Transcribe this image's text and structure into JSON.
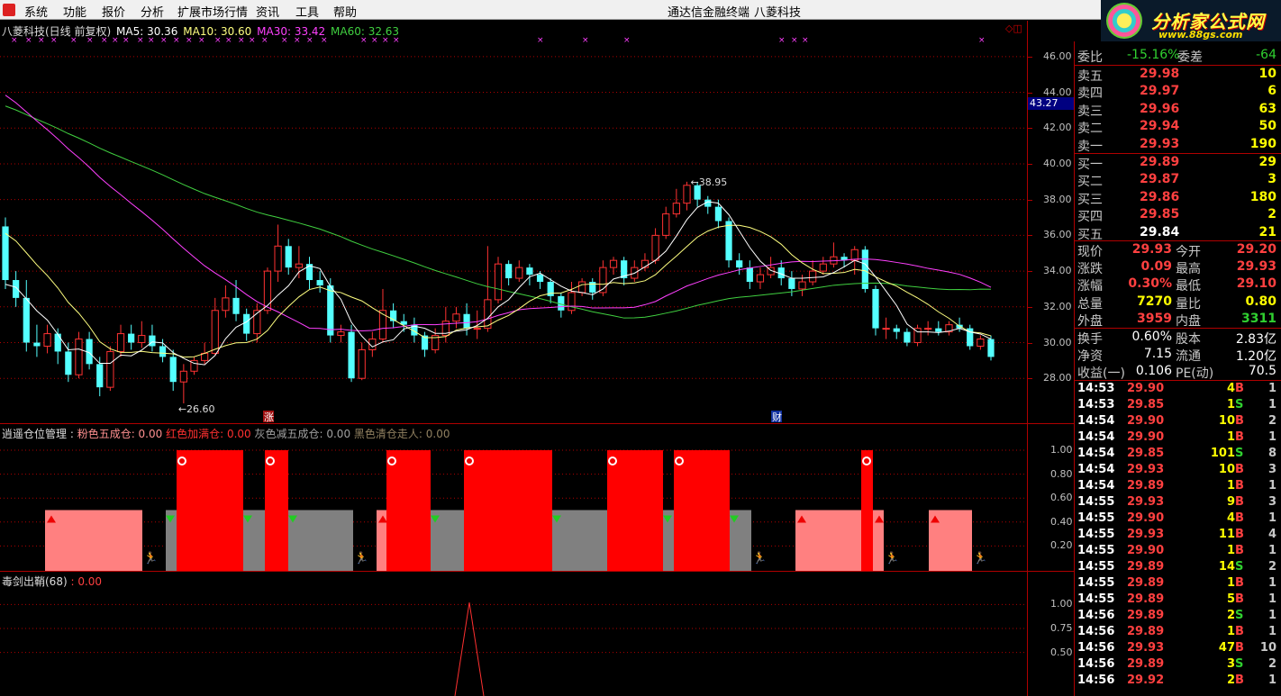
{
  "menu": {
    "items": [
      "系统",
      "功能",
      "报价",
      "分析",
      "扩展市场行情",
      "资讯",
      "工具",
      "帮助"
    ],
    "title": "通达信金融终端",
    "stock": "八菱科技"
  },
  "brand": {
    "site": "分析家公式网",
    "url": "www.88gs.com"
  },
  "ma_header": {
    "name": "八菱科技(日线 前复权)",
    "ma5": "MA5: 30.36",
    "ma10": "MA10: 30.60",
    "ma30": "MA30: 33.42",
    "ma60": "MA60: 32.63"
  },
  "colors": {
    "up": "#ff3232",
    "down": "#54ffff",
    "ma5": "#ffffff",
    "ma10": "#ffff80",
    "ma30": "#ff40ff",
    "ma60": "#40d040",
    "grid": "#b00000"
  },
  "price_axis": {
    "labels": [
      "46.00",
      "44.00",
      "42.00",
      "40.00",
      "38.00",
      "36.00",
      "34.00",
      "32.00",
      "30.00",
      "28.00"
    ],
    "current": "43.27"
  },
  "annotations": {
    "high": "38.95",
    "low": "26.60",
    "zhang": "涨",
    "cai": "财"
  },
  "chart_data": [
    {
      "type": "candlestick",
      "title": "八菱科技(日线 前复权)",
      "ylim": [
        26.5,
        47
      ],
      "candles": [
        [
          36.5,
          33.5,
          37,
          33
        ],
        [
          33.5,
          32.5,
          34,
          32
        ],
        [
          32.5,
          30,
          33.5,
          29.5
        ],
        [
          30,
          29.8,
          31,
          29.2
        ],
        [
          29.8,
          30.5,
          31,
          29.4
        ],
        [
          30.5,
          29.5,
          30.8,
          28.8
        ],
        [
          29.5,
          28.2,
          30,
          27.8
        ],
        [
          28.2,
          30.2,
          30.6,
          28
        ],
        [
          30.2,
          28.8,
          30.6,
          28.5
        ],
        [
          28.8,
          27.5,
          29.2,
          27
        ],
        [
          27.5,
          29.5,
          29.8,
          27.3
        ],
        [
          29.5,
          30.5,
          31,
          29.2
        ],
        [
          30.5,
          30,
          31,
          29.6
        ],
        [
          30,
          30.4,
          31.2,
          29.7
        ],
        [
          30.4,
          29.8,
          31,
          29.5
        ],
        [
          29.8,
          29.2,
          30.2,
          28.9
        ],
        [
          29.2,
          27.8,
          29.6,
          27.3
        ],
        [
          27.8,
          28.4,
          28.8,
          26.6
        ],
        [
          28.4,
          29,
          29.2,
          28.2
        ],
        [
          29,
          29.4,
          30,
          28.8
        ],
        [
          29.4,
          31.8,
          32.5,
          29.3
        ],
        [
          31.8,
          32.5,
          33.2,
          31.4
        ],
        [
          32.5,
          31.6,
          33.5,
          31.2
        ],
        [
          31.6,
          30.5,
          31.9,
          30.1
        ],
        [
          30.5,
          31.8,
          32.2,
          30
        ],
        [
          31.8,
          34,
          34.2,
          31.6
        ],
        [
          34,
          35.4,
          36.6,
          33.4
        ],
        [
          35.4,
          34.2,
          35.8,
          33.8
        ],
        [
          34.2,
          34.4,
          35.4,
          33.6
        ],
        [
          34.4,
          33.5,
          34.8,
          33
        ],
        [
          33.5,
          33.2,
          34,
          32.8
        ],
        [
          33.2,
          30.4,
          33.6,
          30
        ],
        [
          30.4,
          30.6,
          31,
          30
        ],
        [
          30.6,
          28,
          31,
          27.8
        ],
        [
          28,
          29.6,
          30,
          27.9
        ],
        [
          29.6,
          30.2,
          30.6,
          29.2
        ],
        [
          30.2,
          31.8,
          33,
          30
        ],
        [
          31.8,
          31.2,
          32.2,
          30.8
        ],
        [
          31.2,
          31,
          31.6,
          30.6
        ],
        [
          31,
          30.4,
          31.4,
          30
        ],
        [
          30.4,
          29.6,
          30.6,
          29.2
        ],
        [
          29.6,
          30.4,
          30.8,
          29.4
        ],
        [
          30.4,
          31.2,
          32,
          30
        ],
        [
          31.2,
          31.6,
          32,
          30.8
        ],
        [
          31.6,
          30.8,
          32.2,
          30.4
        ],
        [
          30.8,
          30.8,
          31.8,
          30.2
        ],
        [
          30.8,
          32.4,
          35.4,
          30.6
        ],
        [
          32.4,
          34.4,
          34.8,
          32.2
        ],
        [
          34.4,
          33.6,
          34.6,
          33.2
        ],
        [
          33.6,
          34.2,
          34.6,
          33.4
        ],
        [
          34.2,
          33.8,
          34.4,
          33.2
        ],
        [
          33.8,
          33.4,
          34,
          33
        ],
        [
          33.4,
          32.6,
          33.6,
          32.2
        ],
        [
          32.6,
          31.8,
          32.8,
          31.4
        ],
        [
          31.8,
          32.8,
          33.4,
          31.6
        ],
        [
          32.8,
          33.4,
          33.6,
          32.6
        ],
        [
          33.4,
          32.8,
          33.6,
          32.4
        ],
        [
          32.8,
          34.2,
          34.6,
          32.6
        ],
        [
          34.2,
          34.6,
          34.8,
          33.8
        ],
        [
          34.6,
          33.6,
          34.8,
          33.2
        ],
        [
          33.6,
          34.2,
          34.6,
          33.4
        ],
        [
          34.2,
          34.6,
          35,
          34
        ],
        [
          34.6,
          36,
          36.4,
          34.4
        ],
        [
          36,
          37.2,
          37.6,
          35.8
        ],
        [
          37.2,
          37.8,
          38.6,
          37
        ],
        [
          37.8,
          38.8,
          39,
          37.4
        ],
        [
          38.8,
          38,
          39,
          37.6
        ],
        [
          38,
          37.6,
          38.2,
          37.2
        ],
        [
          37.6,
          36.8,
          38,
          36.4
        ],
        [
          36.8,
          34.6,
          37,
          34.2
        ],
        [
          34.6,
          34.2,
          35,
          33.8
        ],
        [
          34.2,
          33.4,
          34.6,
          33
        ],
        [
          33.4,
          33.8,
          34.2,
          33
        ],
        [
          33.8,
          34.2,
          34.8,
          33.6
        ],
        [
          34.2,
          33.6,
          34.6,
          33.2
        ],
        [
          33.6,
          33,
          34,
          32.6
        ],
        [
          33,
          33.4,
          33.8,
          32.6
        ],
        [
          33.4,
          34,
          34.6,
          33.2
        ],
        [
          34,
          34.4,
          34.8,
          33.8
        ],
        [
          34.4,
          34.8,
          35.6,
          34.2
        ],
        [
          34.8,
          34.6,
          35,
          34.2
        ],
        [
          34.6,
          35.2,
          35.4,
          33.8
        ],
        [
          35.2,
          33,
          35.4,
          32.8
        ],
        [
          33,
          30.8,
          33.2,
          30.4
        ],
        [
          30.8,
          30.8,
          31.4,
          30.2
        ],
        [
          30.8,
          30.6,
          31,
          30.2
        ],
        [
          30.6,
          30,
          30.8,
          29.8
        ],
        [
          30,
          30.8,
          31,
          29.8
        ],
        [
          30.8,
          30.8,
          31.2,
          30.4
        ],
        [
          30.8,
          30.6,
          31.2,
          30.4
        ],
        [
          30.6,
          31,
          31.2,
          30.4
        ],
        [
          31,
          30.8,
          31.4,
          30.6
        ],
        [
          30.8,
          29.8,
          31,
          29.6
        ],
        [
          29.8,
          30.2,
          30.4,
          29.6
        ],
        [
          30.2,
          29.2,
          30.4,
          29
        ]
      ]
    },
    {
      "type": "bar",
      "title": "逍遥仓位管理",
      "series_labels": [
        "粉色五成仓: 0.00",
        "红色加满仓: 0.00",
        "灰色减五成仓: 0.00",
        "黑色清仓走人: 0.00"
      ],
      "ylim": [
        0,
        1.1
      ],
      "axis": [
        "1.00",
        "0.80",
        "0.60",
        "0.40",
        "0.20"
      ]
    },
    {
      "type": "line",
      "title": "毒剑出鞘(68)",
      "value": ": 0.00",
      "ylim": [
        0,
        1.2
      ],
      "axis": [
        "1.00",
        "0.75",
        "0.50"
      ]
    }
  ],
  "position_blocks": [
    {
      "kind": "pink",
      "x0": 50,
      "x1": 158,
      "v": 0.5
    },
    {
      "kind": "gray",
      "x0": 184,
      "x1": 196,
      "v": 0.5
    },
    {
      "kind": "red",
      "x0": 196,
      "x1": 270,
      "v": 1.0
    },
    {
      "kind": "gray",
      "x0": 270,
      "x1": 294,
      "v": 0.5
    },
    {
      "kind": "red",
      "x0": 294,
      "x1": 320,
      "v": 1.0
    },
    {
      "kind": "gray",
      "x0": 320,
      "x1": 392,
      "v": 0.5
    },
    {
      "kind": "pink",
      "x0": 418,
      "x1": 429,
      "v": 0.5
    },
    {
      "kind": "red",
      "x0": 429,
      "x1": 478,
      "v": 1.0
    },
    {
      "kind": "gray",
      "x0": 478,
      "x1": 515,
      "v": 0.5
    },
    {
      "kind": "red",
      "x0": 515,
      "x1": 613,
      "v": 1.0
    },
    {
      "kind": "gray",
      "x0": 613,
      "x1": 674,
      "v": 0.5
    },
    {
      "kind": "red",
      "x0": 674,
      "x1": 736,
      "v": 1.0
    },
    {
      "kind": "gray",
      "x0": 736,
      "x1": 748,
      "v": 0.5
    },
    {
      "kind": "red",
      "x0": 748,
      "x1": 810,
      "v": 1.0
    },
    {
      "kind": "gray",
      "x0": 810,
      "x1": 834,
      "v": 0.5
    },
    {
      "kind": "pink",
      "x0": 883,
      "x1": 956,
      "v": 0.5
    },
    {
      "kind": "red",
      "x0": 956,
      "x1": 969,
      "v": 1.0
    },
    {
      "kind": "pink",
      "x0": 969,
      "x1": 981,
      "v": 0.5
    },
    {
      "kind": "pink",
      "x0": 1031,
      "x1": 1079,
      "v": 0.5
    }
  ],
  "quote": {
    "weibi": {
      "label": "委比",
      "value": "-15.16%",
      "label2": "委差",
      "value2": "-64"
    },
    "sell": [
      {
        "l": "卖五",
        "p": "29.98",
        "v": "10"
      },
      {
        "l": "卖四",
        "p": "29.97",
        "v": "6"
      },
      {
        "l": "卖三",
        "p": "29.96",
        "v": "63"
      },
      {
        "l": "卖二",
        "p": "29.94",
        "v": "50"
      },
      {
        "l": "卖一",
        "p": "29.93",
        "v": "190"
      }
    ],
    "buy": [
      {
        "l": "买一",
        "p": "29.89",
        "v": "29"
      },
      {
        "l": "买二",
        "p": "29.87",
        "v": "3"
      },
      {
        "l": "买三",
        "p": "29.86",
        "v": "180"
      },
      {
        "l": "买四",
        "p": "29.85",
        "v": "2"
      },
      {
        "l": "买五",
        "p": "29.84",
        "v": "21"
      }
    ],
    "stats": [
      [
        "现价",
        "29.93",
        "今开",
        "29.20"
      ],
      [
        "涨跌",
        "0.09",
        "最高",
        "29.93"
      ],
      [
        "涨幅",
        "0.30%",
        "最低",
        "29.10"
      ],
      [
        "总量",
        "7270",
        "量比",
        "0.80"
      ],
      [
        "外盘",
        "3959",
        "内盘",
        "3311"
      ]
    ],
    "fund": [
      [
        "换手",
        "0.60%",
        "股本",
        "2.83亿"
      ],
      [
        "净资",
        "7.15",
        "流通",
        "1.20亿"
      ],
      [
        "收益(一)",
        "0.106",
        "PE(动)",
        "70.5"
      ]
    ]
  },
  "ticks": [
    [
      "14:53",
      "29.90",
      "4",
      "B",
      "1"
    ],
    [
      "14:53",
      "29.85",
      "1",
      "S",
      "1"
    ],
    [
      "14:54",
      "29.90",
      "10",
      "B",
      "2"
    ],
    [
      "14:54",
      "29.90",
      "1",
      "B",
      "1"
    ],
    [
      "14:54",
      "29.85",
      "101",
      "S",
      "8"
    ],
    [
      "14:54",
      "29.93",
      "10",
      "B",
      "3"
    ],
    [
      "14:54",
      "29.89",
      "1",
      "B",
      "1"
    ],
    [
      "14:55",
      "29.93",
      "9",
      "B",
      "3"
    ],
    [
      "14:55",
      "29.90",
      "4",
      "B",
      "1"
    ],
    [
      "14:55",
      "29.93",
      "11",
      "B",
      "4"
    ],
    [
      "14:55",
      "29.90",
      "1",
      "B",
      "1"
    ],
    [
      "14:55",
      "29.89",
      "14",
      "S",
      "2"
    ],
    [
      "14:55",
      "29.89",
      "1",
      "B",
      "1"
    ],
    [
      "14:55",
      "29.89",
      "5",
      "B",
      "1"
    ],
    [
      "14:56",
      "29.89",
      "2",
      "S",
      "1"
    ],
    [
      "14:56",
      "29.89",
      "1",
      "B",
      "1"
    ],
    [
      "14:56",
      "29.93",
      "47",
      "B",
      "10"
    ],
    [
      "14:56",
      "29.89",
      "3",
      "S",
      "2"
    ],
    [
      "14:56",
      "29.92",
      "2",
      "B",
      "1"
    ]
  ]
}
